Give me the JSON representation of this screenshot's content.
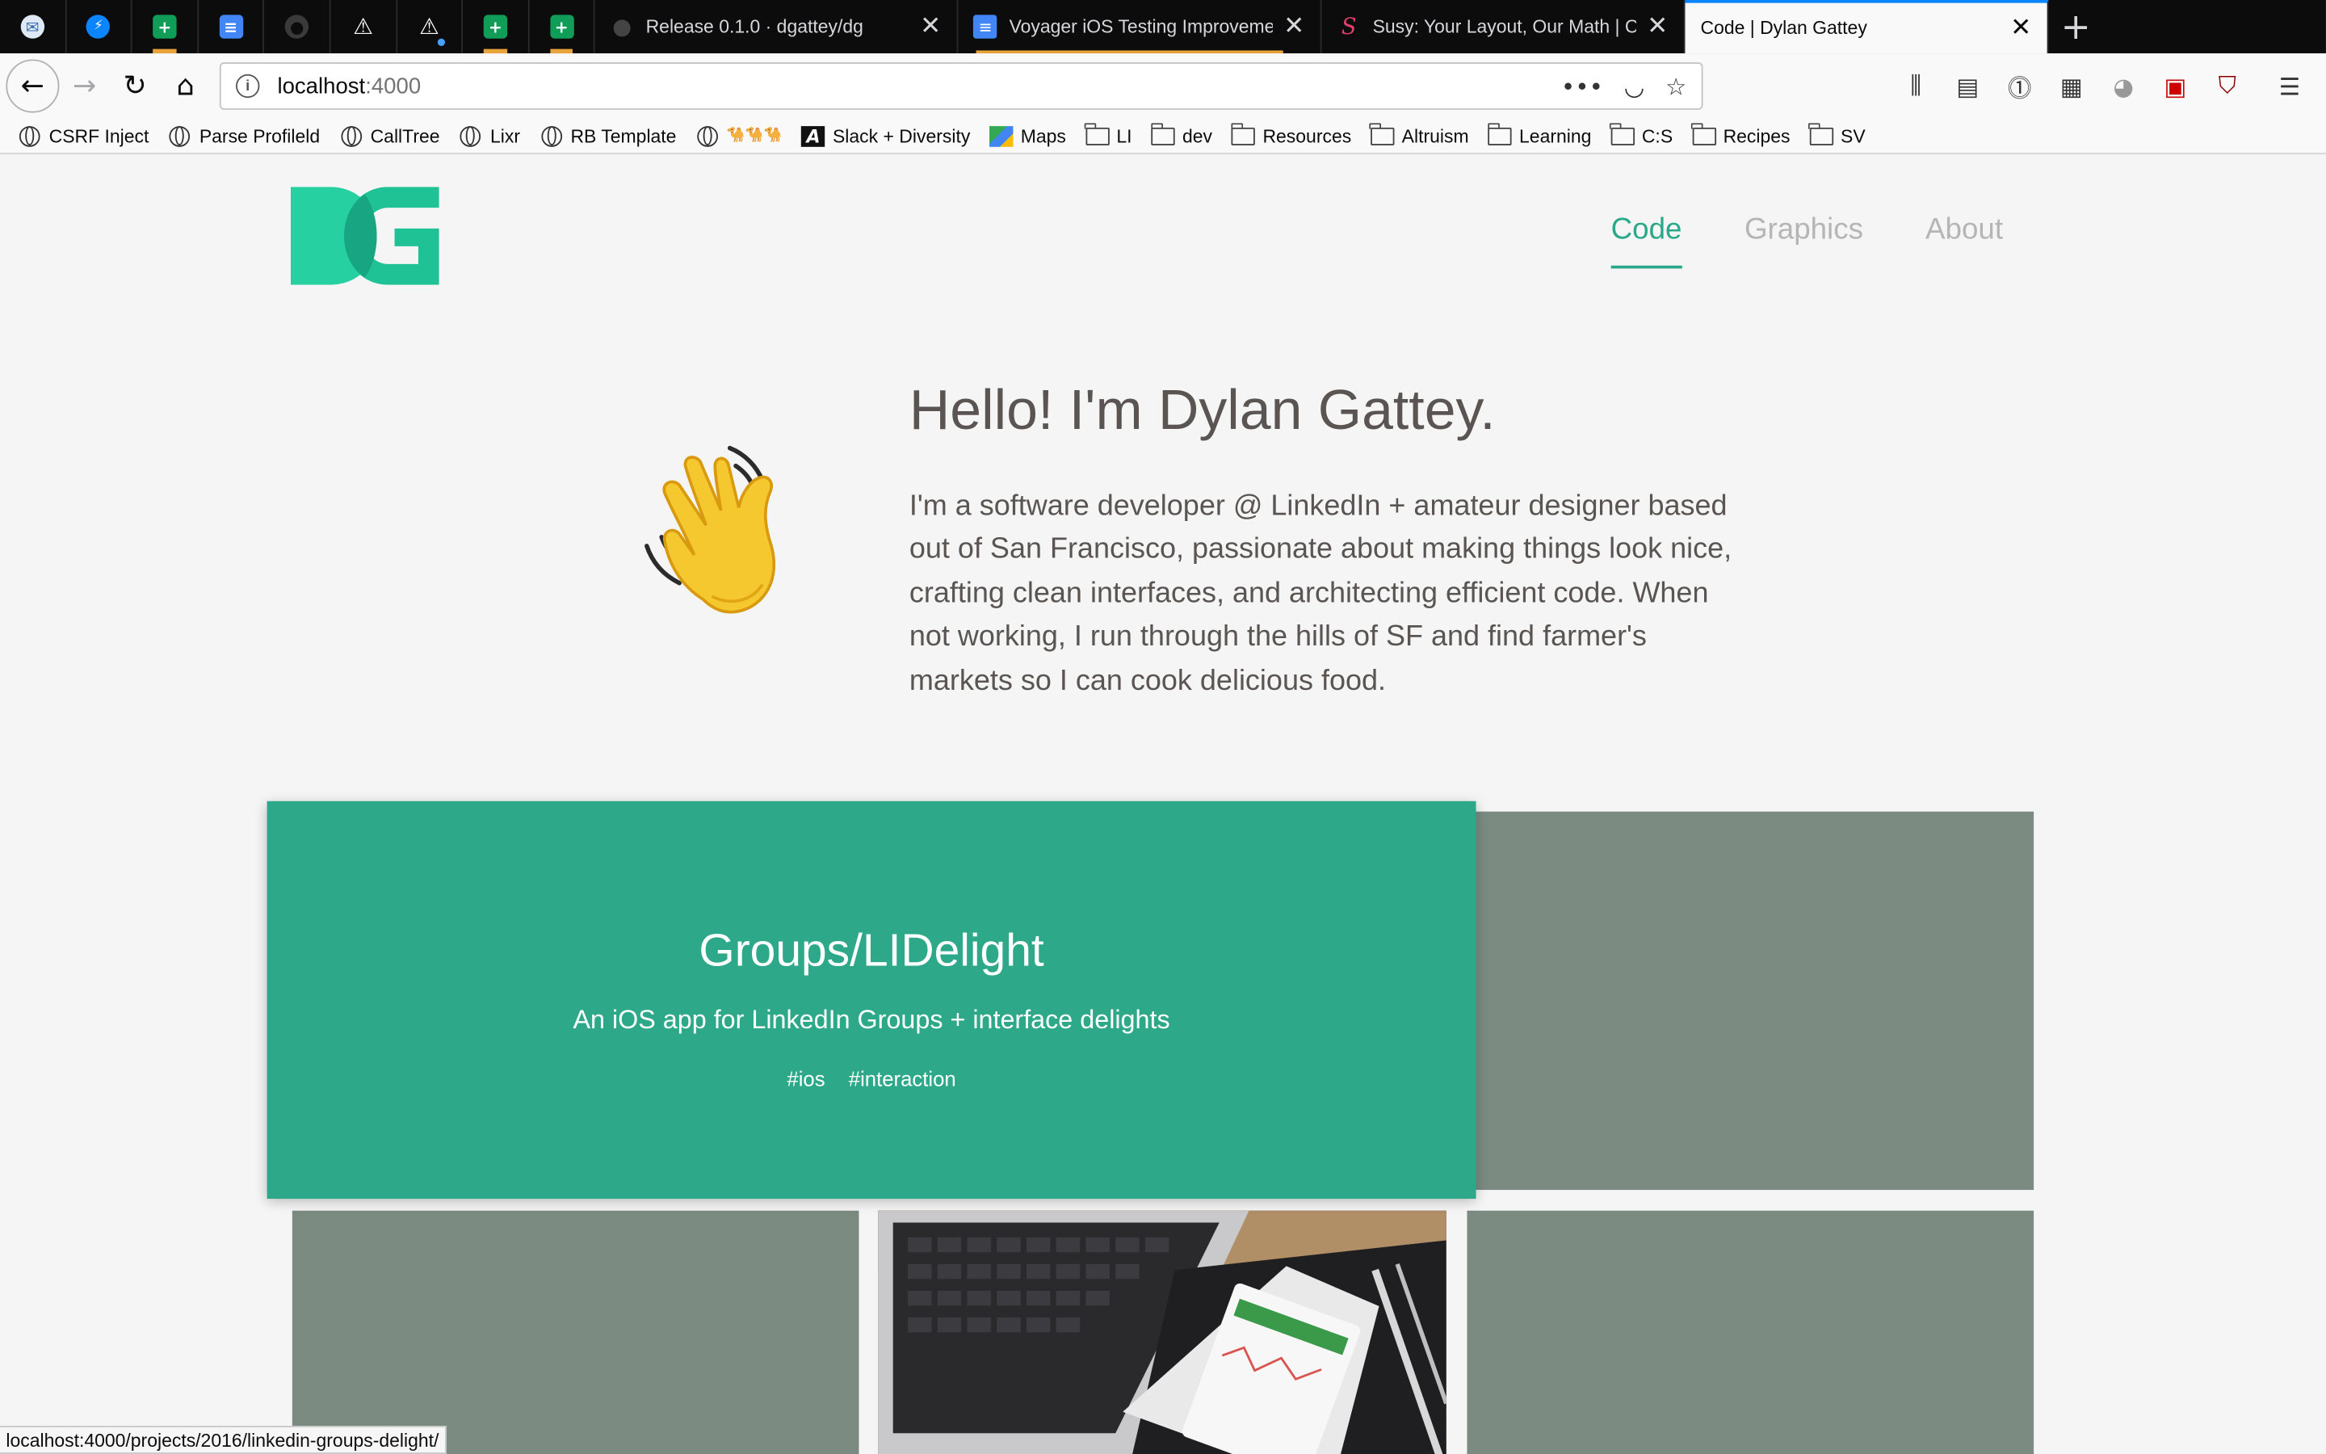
{
  "browser": {
    "pinned_tabs": [
      {
        "icon": "mail-icon",
        "color": "#5b8fd6",
        "glyph": "✉"
      },
      {
        "icon": "messenger-icon",
        "color": "#0a84ff",
        "glyph": "⚡"
      },
      {
        "icon": "sheets-icon",
        "color": "#0f9d58",
        "glyph": "+"
      },
      {
        "icon": "docs-icon",
        "color": "#4285f4",
        "glyph": "≡"
      },
      {
        "icon": "github-icon",
        "color": "#3a3a3a",
        "glyph": "●"
      },
      {
        "icon": "warning-icon",
        "color": "#0c0c0d",
        "glyph": "⚠"
      },
      {
        "icon": "warning-icon",
        "color": "#0c0c0d",
        "glyph": "⚠"
      },
      {
        "icon": "sheets-icon",
        "color": "#0f9d58",
        "glyph": "+"
      },
      {
        "icon": "sheets-icon",
        "color": "#0f9d58",
        "glyph": "+"
      }
    ],
    "tabs": [
      {
        "title": "Release 0.1.0 · dgattey/dg",
        "icon": "github-icon",
        "active": false
      },
      {
        "title": "Voyager iOS Testing Improveme",
        "icon": "docs-icon",
        "active": false
      },
      {
        "title": "Susy: Your Layout, Our Math | C",
        "icon": "susy-icon",
        "active": false
      },
      {
        "title": "Code | Dylan Gattey",
        "icon": "",
        "active": true
      }
    ],
    "url_host": "localhost",
    "url_port": ":4000",
    "bookmarks": [
      {
        "label": "CSRF Inject",
        "icon": "globe-icon"
      },
      {
        "label": "Parse Profileld",
        "icon": "globe-icon"
      },
      {
        "label": "CallTree",
        "icon": "globe-icon"
      },
      {
        "label": "Lixr",
        "icon": "globe-icon"
      },
      {
        "label": "RB Template",
        "icon": "globe-icon"
      },
      {
        "label": "🐪🐪🐪",
        "icon": "globe-icon"
      },
      {
        "label": "Slack + Diversity",
        "icon": "slack-icon"
      },
      {
        "label": "Maps",
        "icon": "maps-icon"
      },
      {
        "label": "LI",
        "icon": "folder-icon"
      },
      {
        "label": "dev",
        "icon": "folder-icon"
      },
      {
        "label": "Resources",
        "icon": "folder-icon"
      },
      {
        "label": "Altruism",
        "icon": "folder-icon"
      },
      {
        "label": "Learning",
        "icon": "folder-icon"
      },
      {
        "label": "C:S",
        "icon": "folder-icon"
      },
      {
        "label": "Recipes",
        "icon": "folder-icon"
      },
      {
        "label": "SV",
        "icon": "folder-icon"
      }
    ],
    "status_url": "localhost:4000/projects/2016/linkedin-groups-delight/"
  },
  "site": {
    "logo_text": "DG",
    "accent_color": "#29a88a",
    "nav": [
      {
        "label": "Code",
        "active": true
      },
      {
        "label": "Graphics",
        "active": false
      },
      {
        "label": "About",
        "active": false
      }
    ],
    "hero": {
      "title": "Hello! I'm Dylan Gattey.",
      "body": "I'm a software developer @ LinkedIn + amateur designer based out of San Francisco, passionate about making things look nice, crafting clean interfaces, and architecting efficient code. When not working, I run through the hills of SF and find farmer's markets so I can cook delicious food.",
      "emoji": "waving-hand-icon"
    },
    "featured_project": {
      "title": "Groups/LIDelight",
      "subtitle": "An iOS app for LinkedIn Groups + interface delights",
      "tags": [
        "#ios",
        "#interaction"
      ]
    }
  }
}
